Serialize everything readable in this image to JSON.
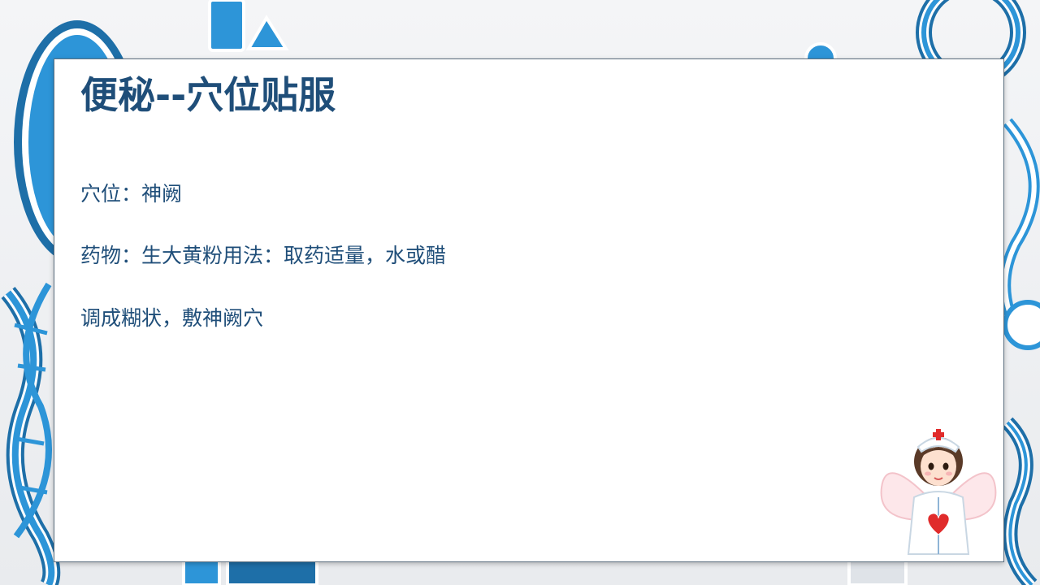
{
  "slide": {
    "title": "便秘--穴位贴服",
    "lines": [
      "穴位：神阙",
      "药物：生大黄粉用法：取药适量，水或醋",
      "调成糊状，敷神阙穴"
    ]
  },
  "colors": {
    "title": "#1f4e79",
    "body_text": "#1f4e79",
    "accent_blue": "#2d95d8",
    "card_border": "#5c6f7f"
  },
  "decorations": {
    "background": "blue-white-medical-shapes",
    "corner_illustration": "nurse-angel-with-heart-icon"
  }
}
